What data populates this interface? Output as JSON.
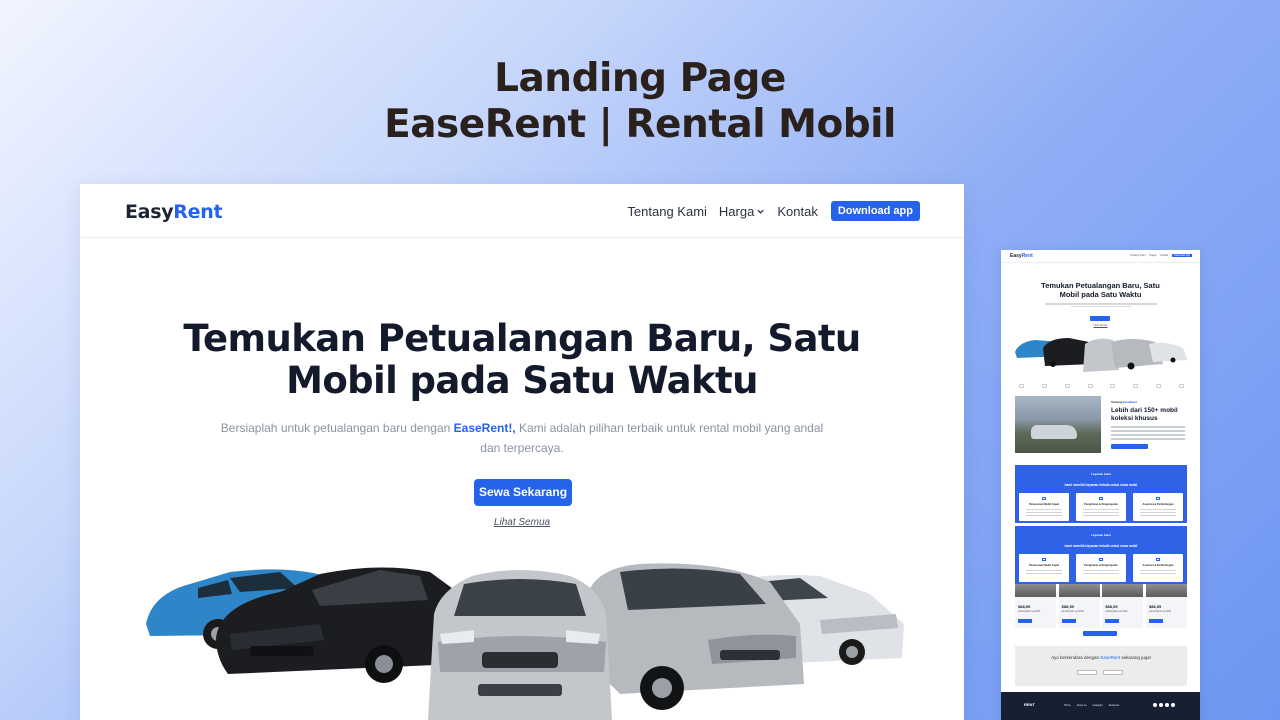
{
  "showcase": {
    "line1": "Landing Page",
    "line2": "EaseRent | Rental Mobil"
  },
  "nav": {
    "logo_a": "Easy",
    "logo_b": "Rent",
    "links": [
      "Tentang Kami",
      "Harga",
      "Kontak"
    ],
    "download_label": "Download app"
  },
  "hero": {
    "title_line1": "Temukan Petualangan Baru, Satu",
    "title_line2": "Mobil pada Satu Waktu",
    "sub_before": "Bersiaplah untuk petualangan baru dengan ",
    "sub_brand": "EaseRent!,",
    "sub_after": " Kami adalah pilihan terbaik untuk rental mobil yang andal dan terpercaya.",
    "cta_label": "Sewa Sekarang",
    "link_label": "Lihat Semua"
  },
  "preview": {
    "logo_a": "Easy",
    "logo_b": "Rent",
    "links": [
      "Tentang Kami",
      "Harga",
      "Kontak"
    ],
    "download_label": "Download app",
    "title_line1": "Temukan Petualangan Baru, Satu",
    "title_line2": "Mobil pada Satu Waktu",
    "link_label": "Lihat Semua",
    "about_label_a": "Tentang ",
    "about_label_b": "EaseRent",
    "about_title": "Lebih dari 150+ mobil koleksi khusus",
    "services_label": "Layanan kami",
    "services_title": "kami memiliki layanan terbaik untuk sewa mobil",
    "cards": [
      "Pemesanan Mobil Cepat",
      "Pengiriman & Penjemputan",
      "Asuransi & Perlindungan"
    ],
    "prices": [
      {
        "price": "$88,59",
        "sub": "Lamborghini red 2021"
      },
      {
        "price": "$88,59",
        "sub": "Lamborghini red 2021"
      },
      {
        "price": "$88,59",
        "sub": "Lamborghini red 2021"
      },
      {
        "price": "$88,59",
        "sub": "Lamborghini red 2021"
      }
    ],
    "cta_before": "Ayo berkendara dengan ",
    "cta_brand": "EaseRent",
    "cta_after": " sekarang juga!",
    "footer_logo": "RENT",
    "footer_links": [
      "Home",
      "About us",
      "Category",
      "Resource"
    ]
  },
  "colors": {
    "accent": "#2563eb",
    "heading": "#121a2b",
    "muted": "#8a93a3",
    "footer": "#172033"
  }
}
